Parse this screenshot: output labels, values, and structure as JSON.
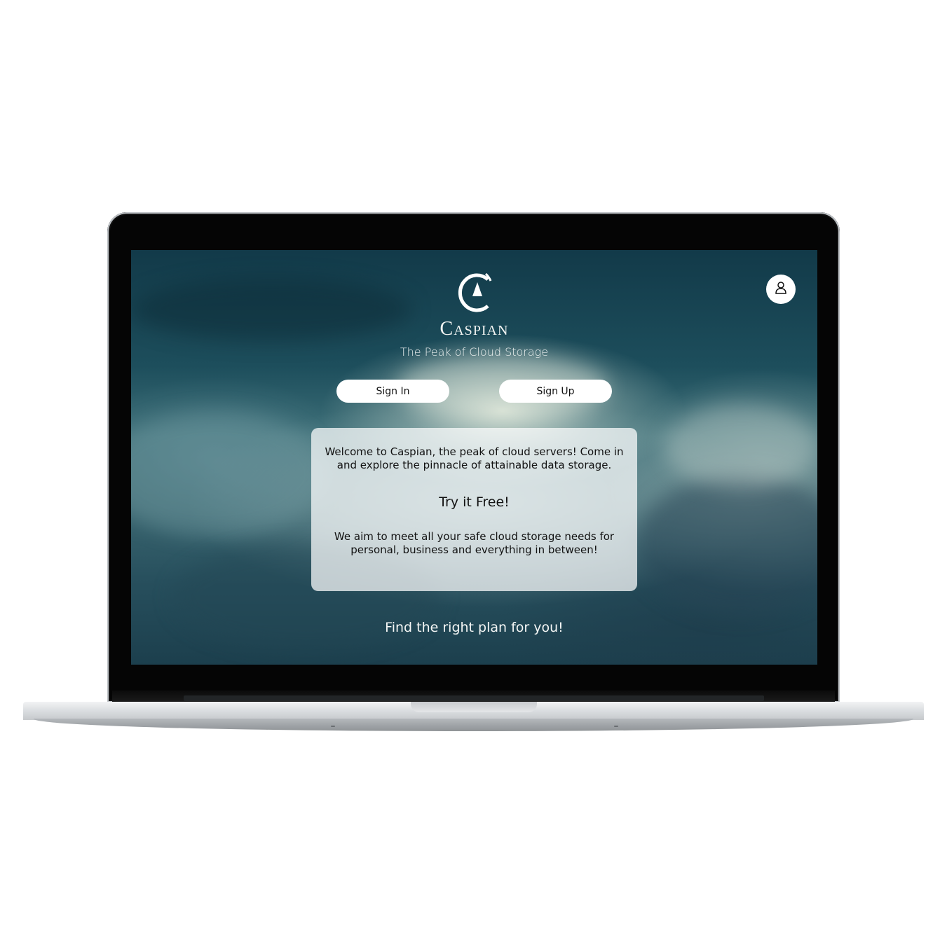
{
  "brand": {
    "name": "Caspian",
    "tagline": "The Peak of Cloud Storage",
    "logo_icon": "caspian-c-peak-logo"
  },
  "header": {
    "profile_icon": "user-icon"
  },
  "auth": {
    "sign_in_label": "Sign In",
    "sign_up_label": "Sign Up"
  },
  "card": {
    "intro": "Welcome to Caspian, the peak of cloud servers! Come in and explore the pinnacle of attainable data storage.",
    "cta": "Try it Free!",
    "mission": "We aim to meet all your safe cloud storage needs for personal, business and everything in between!"
  },
  "footer": {
    "plan_link": "Find the right plan for you!"
  },
  "colors": {
    "sky_dark": "#123a49",
    "sky_mid": "#3d6f78",
    "card_bg": "rgba(255,255,255,0.72)",
    "bezel": "#050505"
  }
}
